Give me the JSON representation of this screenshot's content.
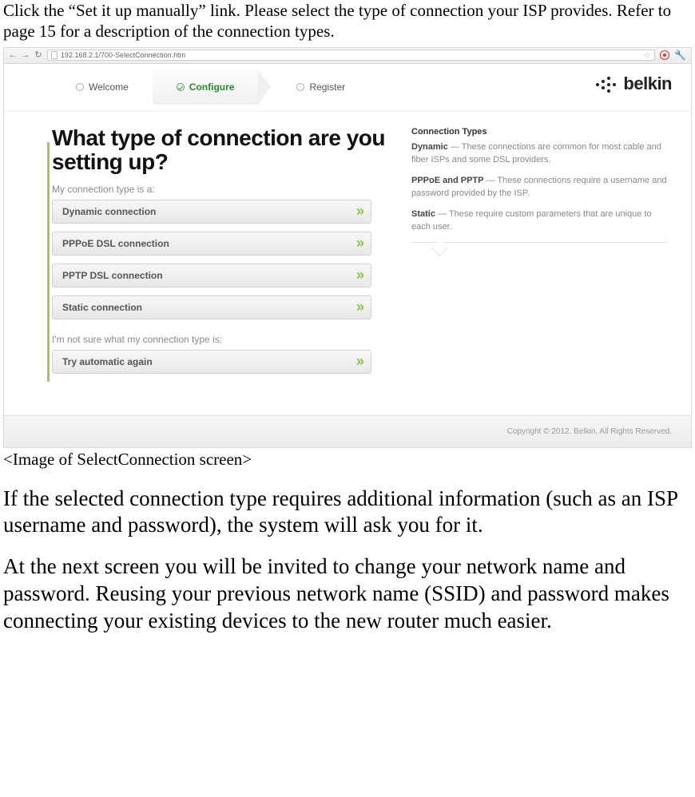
{
  "doc": {
    "intro": "Click the “Set it up manually” link. Please select the type of connection your ISP provides. Refer to page 15 for a description of the connection types.",
    "caption": "<Image of SelectConnection screen>",
    "para1": "If the selected connection type requires additional information (such as an ISP username and password), the system will ask you for it.",
    "para2": "At the next screen you will be invited to change your network name and password. Reusing your previous network name (SSID) and password makes connecting your existing devices to the new router much easier."
  },
  "browser": {
    "url": "192.168.2.1/700-SelectConnection.htm"
  },
  "steps": {
    "s1": "Welcome",
    "s2": "Configure",
    "s3": "Register"
  },
  "brand": "belkin",
  "page": {
    "heading": "What type of connection are you setting up?",
    "label1": "My connection type is a:",
    "label2": "I'm not sure what my connection type is:",
    "options": {
      "o1": "Dynamic connection",
      "o2": "PPPoE DSL connection",
      "o3": "PPTP DSL connection",
      "o4": "Static connection",
      "o5": "Try automatic again"
    }
  },
  "side": {
    "title": "Connection Types",
    "dynamic_b": "Dynamic",
    "dynamic_t": " — These connections are common for most cable and fiber ISPs and some DSL providers.",
    "pppoe_b": "PPPoE and PPTP",
    "pppoe_t": " — These connections require a username and password provided by the ISP.",
    "static_b": "Static",
    "static_t": " — These require custom parameters that are unique to each user."
  },
  "footer": "Copyright © 2012. Belkin, All Rights Reserved."
}
